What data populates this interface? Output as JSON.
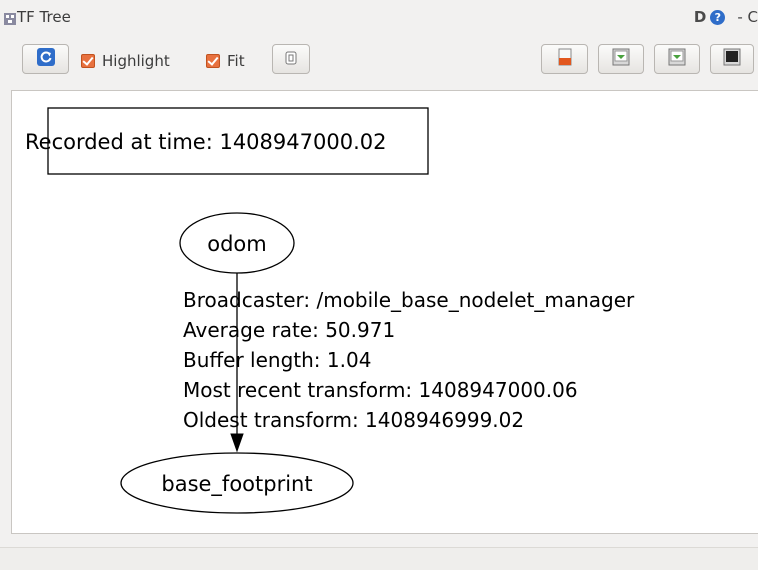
{
  "window": {
    "title": "TF Tree",
    "help_letter": "D",
    "help_icon": "?",
    "title_trailing": "-  C"
  },
  "toolbar": {
    "refresh_icon": "refresh-icon",
    "highlight_label": "Highlight",
    "highlight_checked": true,
    "fit_label": "Fit",
    "fit_checked": true,
    "right_buttons": [
      "load-dot-icon",
      "save-dot-icon",
      "save-svg-icon",
      "save-image-icon"
    ]
  },
  "graph": {
    "recorded_label": "Recorded at time: 1408947000.02",
    "parent_frame": "odom",
    "child_frame": "base_footprint",
    "edge": {
      "broadcaster": "Broadcaster: /mobile_base_nodelet_manager",
      "average_rate": "Average rate: 50.971",
      "buffer_length": "Buffer length: 1.04",
      "most_recent": "Most recent transform: 1408947000.06",
      "oldest": "Oldest transform: 1408946999.02"
    }
  },
  "colors": {
    "checkbox": "#e8713f",
    "refresh_icon": "#2f6dc9"
  }
}
